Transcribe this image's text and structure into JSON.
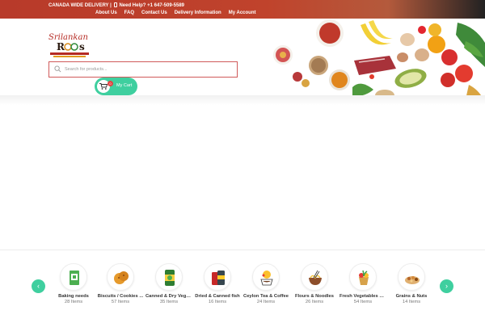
{
  "topbar": {
    "promo_text": "CANADA WIDE DELIVERY |",
    "phone_text": "Need Help? +1 647-509-5589",
    "nav": [
      "About Us",
      "FAQ",
      "Contact Us",
      "Delivery Information",
      "My Account"
    ]
  },
  "header": {
    "logo_text": "Srilankan Roots",
    "search_placeholder": "Search for products...",
    "cart_label": "My Cart",
    "cart_count": "0"
  },
  "categories": [
    {
      "name": "Baking needs",
      "count": "28 Items",
      "icon": "baking-icon"
    },
    {
      "name": "Biscuits / Cookies ...",
      "count": "57 Items",
      "icon": "cookies-icon"
    },
    {
      "name": "Canned & Dry Vegg...",
      "count": "35 Items",
      "icon": "canned-veg-icon"
    },
    {
      "name": "Dried & Canned fish",
      "count": "16 Items",
      "icon": "canned-fish-icon"
    },
    {
      "name": "Ceylon Tea & Coffee",
      "count": "24 Items",
      "icon": "tea-icon"
    },
    {
      "name": "Flours & Noodles",
      "count": "26 Items",
      "icon": "noodles-icon"
    },
    {
      "name": "Fresh Vegetables &...",
      "count": "54 Items",
      "icon": "vegetables-icon"
    },
    {
      "name": "Grains & Nuts",
      "count": "14 Items",
      "icon": "nuts-icon"
    }
  ],
  "colors": {
    "accent": "#3fcf9f",
    "brand": "#c0432c",
    "search_border": "#d05a5a"
  }
}
